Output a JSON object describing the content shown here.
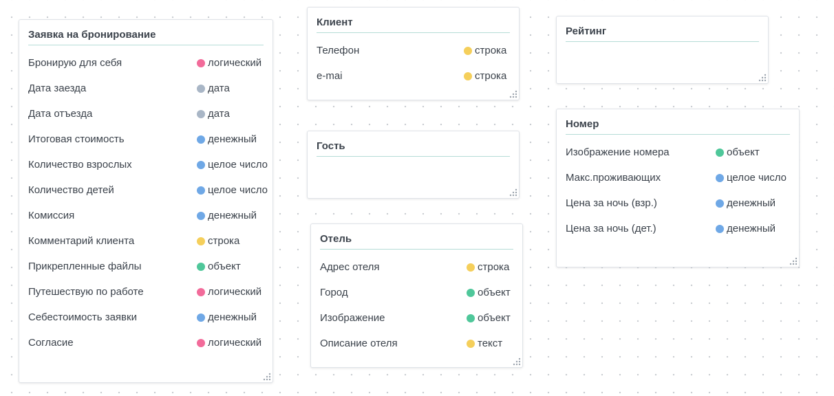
{
  "type_colors": {
    "логический": "#f26b9a",
    "дата": "#a9b6c6",
    "денежный": "#6fa8e6",
    "целое число": "#6fa8e6",
    "строка": "#f5cf5b",
    "объект": "#4fc79a",
    "текст": "#f5cf5b"
  },
  "cards": {
    "booking": {
      "title": "Заявка на бронирование",
      "fields": [
        {
          "name": "Бронирую для себя",
          "type": "логический"
        },
        {
          "name": "Дата заезда",
          "type": "дата"
        },
        {
          "name": "Дата отъезда",
          "type": "дата"
        },
        {
          "name": "Итоговая стоимость",
          "type": "денежный"
        },
        {
          "name": "Количество взрослых",
          "type": "целое число"
        },
        {
          "name": "Количество детей",
          "type": "целое число"
        },
        {
          "name": "Комиссия",
          "type": "денежный"
        },
        {
          "name": "Комментарий клиента",
          "type": "строка"
        },
        {
          "name": "Прикрепленные файлы",
          "type": "объект"
        },
        {
          "name": "Путешествую по работе",
          "type": "логический"
        },
        {
          "name": "Себестоимость заявки",
          "type": "денежный"
        },
        {
          "name": "Согласие",
          "type": "логический"
        }
      ]
    },
    "client": {
      "title": "Клиент",
      "fields": [
        {
          "name": "Телефон",
          "type": "строка"
        },
        {
          "name": "e-mai",
          "type": "строка"
        }
      ]
    },
    "guest": {
      "title": "Гость",
      "fields": []
    },
    "hotel": {
      "title": "Отель",
      "fields": [
        {
          "name": "Адрес отеля",
          "type": "строка"
        },
        {
          "name": "Город",
          "type": "объект"
        },
        {
          "name": "Изображение",
          "type": "объект"
        },
        {
          "name": "Описание отеля",
          "type": "текст"
        }
      ]
    },
    "rating": {
      "title": "Рейтинг",
      "fields": []
    },
    "room": {
      "title": "Номер",
      "fields": [
        {
          "name": "Изображение номера",
          "type": "объект"
        },
        {
          "name": "Макс.проживающих",
          "type": "целое число"
        },
        {
          "name": "Цена за ночь (взр.)",
          "type": "денежный"
        },
        {
          "name": "Цена за ночь (дет.)",
          "type": "денежный"
        }
      ]
    }
  }
}
